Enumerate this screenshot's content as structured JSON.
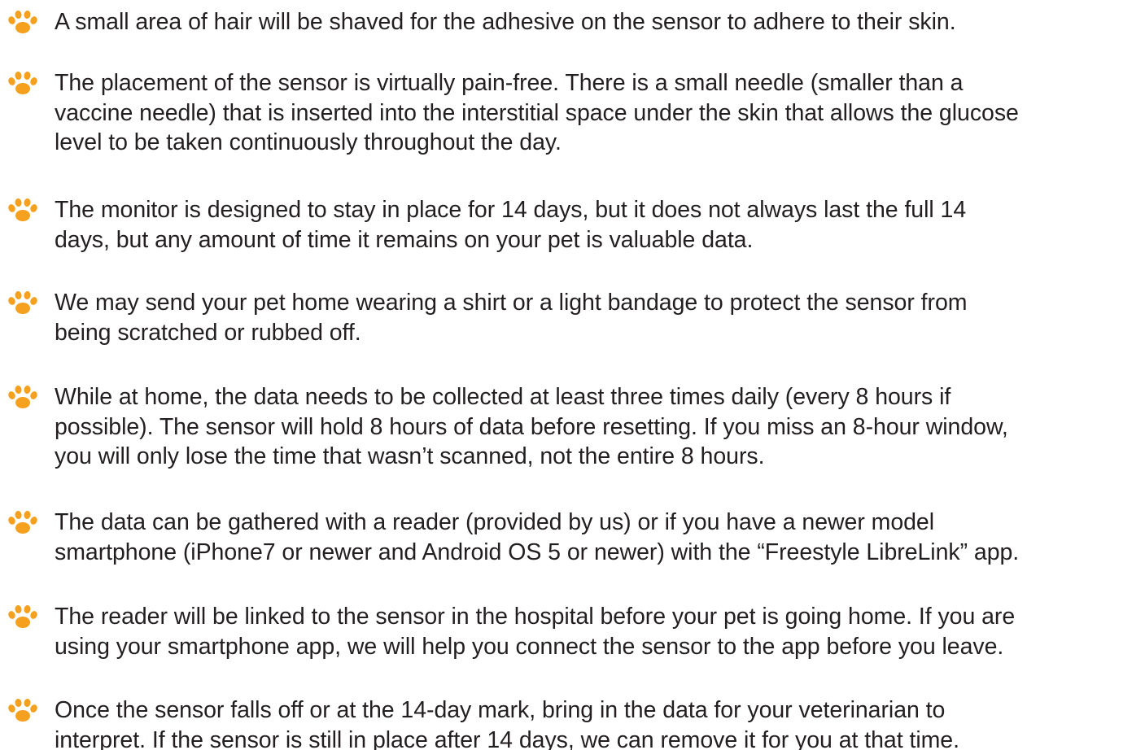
{
  "icon": {
    "name": "paw-print-icon",
    "color": "#F5A01E"
  },
  "bullets": [
    {
      "text": "A small area of hair will be shaved for the adhesive on the sensor to adhere to their skin."
    },
    {
      "text": "The placement of the sensor is virtually pain-free. There is a small needle (smaller than a\nvaccine needle) that is inserted into the interstitial space under the skin that allows the glucose\nlevel to be taken continuously throughout the day."
    },
    {
      "text": "The monitor is designed to stay in place for 14 days, but it does not always last the full 14\ndays, but any amount of time it remains on your pet is valuable data."
    },
    {
      "text": "We may send your pet home wearing a shirt or a light bandage to protect the sensor from\nbeing scratched or rubbed off."
    },
    {
      "text": "While at home, the data needs to be collected at least three times daily (every 8 hours if\npossible). The sensor will hold 8 hours of data before resetting. If you miss an 8-hour window,\nyou will only lose the time that wasn’t scanned, not the entire 8 hours."
    },
    {
      "text": "The data can be gathered with a reader (provided by us) or if you have a newer model\nsmartphone (iPhone7 or newer and Android OS 5 or newer) with the “Freestyle LibreLink” app."
    },
    {
      "text": "The reader will be linked to the sensor in the hospital before your pet is going home. If you are\nusing your smartphone app, we will help you connect the sensor to the app before you leave."
    },
    {
      "text": "Once the sensor falls off or at the 14-day mark, bring in the data for your veterinarian to\ninterpret. If the sensor is still in place after 14 days, we can remove it for you at that time."
    }
  ]
}
